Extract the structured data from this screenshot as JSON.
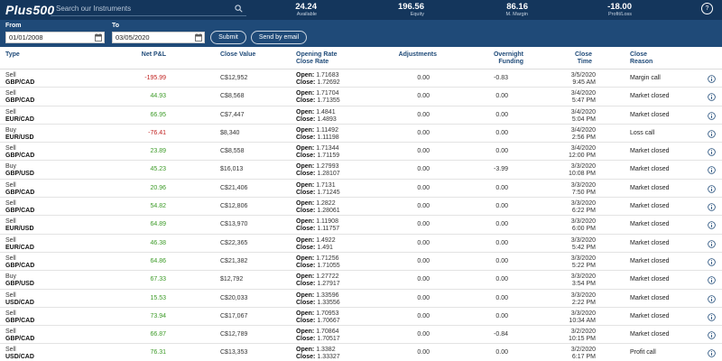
{
  "brand": "Plus500",
  "search": {
    "placeholder": "Search our Instruments"
  },
  "stats": [
    {
      "value": "24.24",
      "label": "Available"
    },
    {
      "value": "196.56",
      "label": "Equity"
    },
    {
      "value": "86.16",
      "label": "M. Margin"
    },
    {
      "value": "-18.00",
      "label": "Profit/Loss"
    }
  ],
  "help_label": "?",
  "filters": {
    "from_label": "From",
    "from_value": "01/01/2008",
    "to_label": "To",
    "to_value": "03/05/2020",
    "submit_label": "Submit",
    "email_label": "Send by email"
  },
  "columns": {
    "type": "Type",
    "pnl": "Net P&L",
    "close_value": "Close Value",
    "rates_1": "Opening Rate",
    "rates_2": "Close Rate",
    "adjustments": "Adjustments",
    "overnight": "Overnight Funding",
    "time_1": "Close",
    "time_2": "Time",
    "reason_1": "Close",
    "reason_2": "Reason"
  },
  "rate_labels": {
    "open": "Open:",
    "close": "Close:"
  },
  "rows": [
    {
      "side": "Sell",
      "instrument": "GBP/CAD",
      "pnl": "-195.99",
      "close_value": "C$12,952",
      "open_rate": "1.71683",
      "close_rate": "1.72692",
      "adjustments": "0.00",
      "overnight": "-0.83",
      "date": "3/5/2020",
      "time": "9:45 AM",
      "reason": "Margin call"
    },
    {
      "side": "Sell",
      "instrument": "GBP/CAD",
      "pnl": "44.93",
      "close_value": "C$8,568",
      "open_rate": "1.71704",
      "close_rate": "1.71355",
      "adjustments": "0.00",
      "overnight": "0.00",
      "date": "3/4/2020",
      "time": "5:47 PM",
      "reason": "Market closed"
    },
    {
      "side": "Sell",
      "instrument": "EUR/CAD",
      "pnl": "66.95",
      "close_value": "C$7,447",
      "open_rate": "1.4841",
      "close_rate": "1.4893",
      "adjustments": "0.00",
      "overnight": "0.00",
      "date": "3/4/2020",
      "time": "5:04 PM",
      "reason": "Market closed"
    },
    {
      "side": "Buy",
      "instrument": "EUR/USD",
      "pnl": "-76.41",
      "close_value": "$8,340",
      "open_rate": "1.11492",
      "close_rate": "1.11198",
      "adjustments": "0.00",
      "overnight": "0.00",
      "date": "3/4/2020",
      "time": "2:56 PM",
      "reason": "Loss call"
    },
    {
      "side": "Sell",
      "instrument": "GBP/CAD",
      "pnl": "23.89",
      "close_value": "C$8,558",
      "open_rate": "1.71344",
      "close_rate": "1.71159",
      "adjustments": "0.00",
      "overnight": "0.00",
      "date": "3/4/2020",
      "time": "12:00 PM",
      "reason": "Market closed"
    },
    {
      "side": "Buy",
      "instrument": "GBP/USD",
      "pnl": "45.23",
      "close_value": "$16,013",
      "open_rate": "1.27993",
      "close_rate": "1.28107",
      "adjustments": "0.00",
      "overnight": "-3.99",
      "date": "3/3/2020",
      "time": "10:08 PM",
      "reason": "Market closed"
    },
    {
      "side": "Sell",
      "instrument": "GBP/CAD",
      "pnl": "20.96",
      "close_value": "C$21,406",
      "open_rate": "1.7131",
      "close_rate": "1.71245",
      "adjustments": "0.00",
      "overnight": "0.00",
      "date": "3/3/2020",
      "time": "7:50 PM",
      "reason": "Market closed"
    },
    {
      "side": "Sell",
      "instrument": "GBP/CAD",
      "pnl": "54.82",
      "close_value": "C$12,806",
      "open_rate": "1.2822",
      "close_rate": "1.28061",
      "adjustments": "0.00",
      "overnight": "0.00",
      "date": "3/3/2020",
      "time": "6:22 PM",
      "reason": "Market closed"
    },
    {
      "side": "Sell",
      "instrument": "EUR/USD",
      "pnl": "64.89",
      "close_value": "C$13,970",
      "open_rate": "1.11908",
      "close_rate": "1.11757",
      "adjustments": "0.00",
      "overnight": "0.00",
      "date": "3/3/2020",
      "time": "6:00 PM",
      "reason": "Market closed"
    },
    {
      "side": "Sell",
      "instrument": "EUR/CAD",
      "pnl": "46.38",
      "close_value": "C$22,365",
      "open_rate": "1.4922",
      "close_rate": "1.491",
      "adjustments": "0.00",
      "overnight": "0.00",
      "date": "3/3/2020",
      "time": "5:42 PM",
      "reason": "Market closed"
    },
    {
      "side": "Sell",
      "instrument": "GBP/CAD",
      "pnl": "64.86",
      "close_value": "C$21,382",
      "open_rate": "1.71256",
      "close_rate": "1.71055",
      "adjustments": "0.00",
      "overnight": "0.00",
      "date": "3/3/2020",
      "time": "5:22 PM",
      "reason": "Market closed"
    },
    {
      "side": "Buy",
      "instrument": "GBP/USD",
      "pnl": "67.33",
      "close_value": "$12,792",
      "open_rate": "1.27722",
      "close_rate": "1.27917",
      "adjustments": "0.00",
      "overnight": "0.00",
      "date": "3/3/2020",
      "time": "3:54 PM",
      "reason": "Market closed"
    },
    {
      "side": "Sell",
      "instrument": "USD/CAD",
      "pnl": "15.53",
      "close_value": "C$20,033",
      "open_rate": "1.33596",
      "close_rate": "1.33556",
      "adjustments": "0.00",
      "overnight": "0.00",
      "date": "3/3/2020",
      "time": "2:22 PM",
      "reason": "Market closed"
    },
    {
      "side": "Sell",
      "instrument": "GBP/CAD",
      "pnl": "73.94",
      "close_value": "C$17,067",
      "open_rate": "1.70953",
      "close_rate": "1.70667",
      "adjustments": "0.00",
      "overnight": "0.00",
      "date": "3/3/2020",
      "time": "10:34 AM",
      "reason": "Market closed"
    },
    {
      "side": "Sell",
      "instrument": "GBP/CAD",
      "pnl": "66.87",
      "close_value": "C$12,789",
      "open_rate": "1.70864",
      "close_rate": "1.70517",
      "adjustments": "0.00",
      "overnight": "-0.84",
      "date": "3/2/2020",
      "time": "10:15 PM",
      "reason": "Market closed"
    },
    {
      "side": "Sell",
      "instrument": "USD/CAD",
      "pnl": "76.31",
      "close_value": "C$13,353",
      "open_rate": "1.3382",
      "close_rate": "1.33327",
      "adjustments": "0.00",
      "overnight": "0.00",
      "date": "3/2/2020",
      "time": "6:17 PM",
      "reason": "Profit call"
    }
  ],
  "colors": {
    "topbar": "#14365c",
    "filterbar": "#1f4a78",
    "positive": "#3b9a26",
    "negative": "#c0211f",
    "header_text": "#1f4a78"
  }
}
